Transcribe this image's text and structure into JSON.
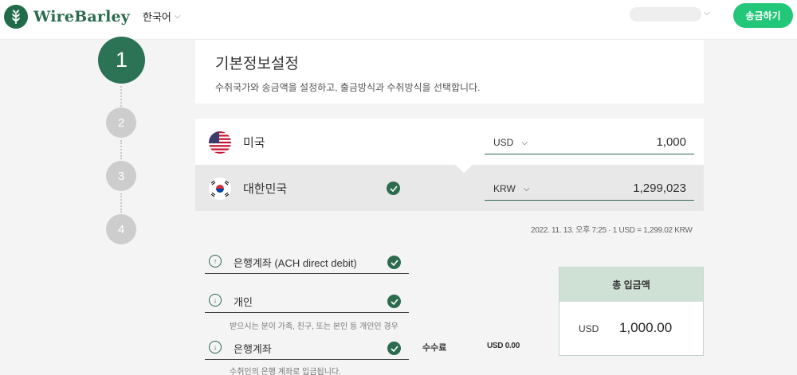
{
  "header": {
    "brand": "WireBarley",
    "language": "한국어",
    "send_button": "송금하기"
  },
  "stepper": [
    "1",
    "2",
    "3",
    "4"
  ],
  "section": {
    "title": "기본정보설정",
    "subtitle": "수취국가와 송금액을 설정하고, 출금방식과 수취방식을 선택합니다."
  },
  "sender": {
    "country": "미국",
    "currency": "USD",
    "amount": "1,000"
  },
  "receiver": {
    "country": "대한민국",
    "currency": "KRW",
    "amount": "1,299,023"
  },
  "rate_info": "2022. 11. 13. 오후 7:25  ·  1 USD = 1,299.02 KRW",
  "methods": {
    "payment": {
      "label": "은행계좌 (ACH direct debit)"
    },
    "recipient_type": {
      "label": "개인",
      "hint": "받으시는 분이 가족, 친구, 또는 본인 등 개인인 경우"
    },
    "receive": {
      "label": "은행계좌",
      "hint": "수취인의 은행 계좌로 입금됩니다."
    }
  },
  "fee": {
    "label": "수수료",
    "value": "USD 0.00"
  },
  "total": {
    "title": "총 입금액",
    "currency": "USD",
    "amount": "1,000.00"
  },
  "colors": {
    "brand": "#2c6b4e",
    "button": "#22c77a",
    "total_header": "#cfe0d5"
  }
}
